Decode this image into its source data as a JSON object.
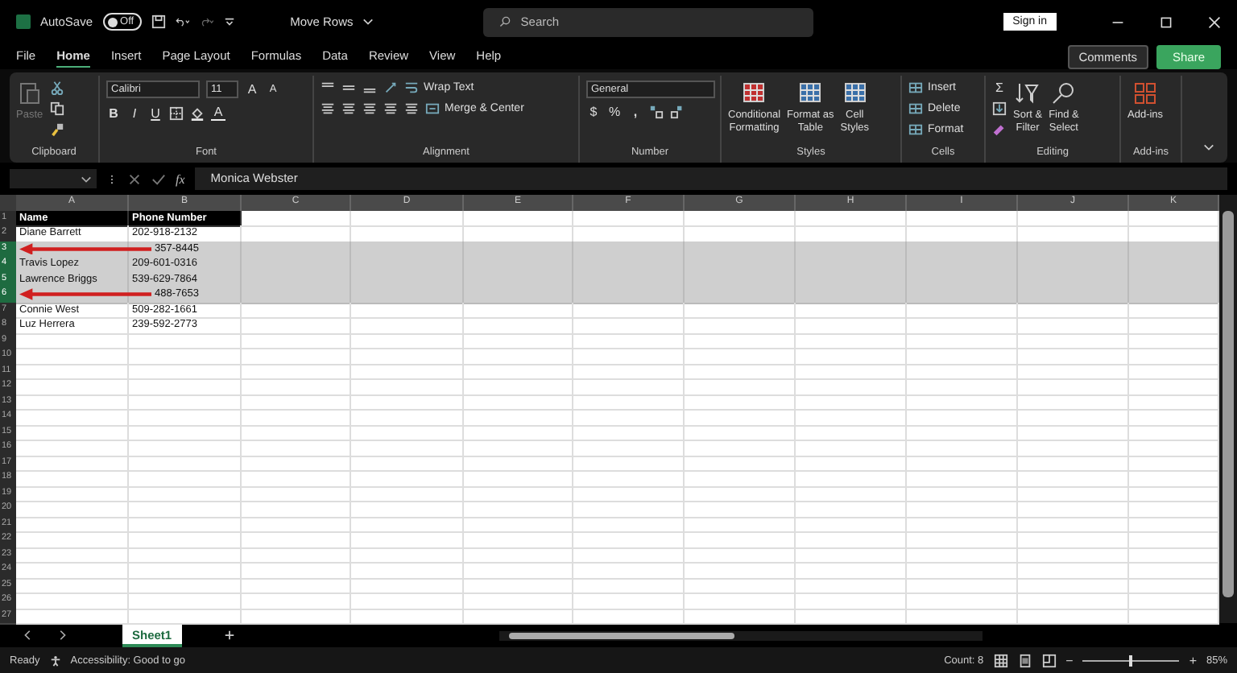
{
  "title_bar": {
    "autosave_label": "AutoSave",
    "autosave_on": false,
    "toggle_text": "Off",
    "document": "Move Rows",
    "search_placeholder": "Search",
    "sign_in": "Sign in"
  },
  "menu_tabs": [
    {
      "label": "File",
      "selected": false
    },
    {
      "label": "Home",
      "selected": true
    },
    {
      "label": "Insert",
      "selected": false
    },
    {
      "label": "Page Layout",
      "selected": false
    },
    {
      "label": "Formulas",
      "selected": false
    },
    {
      "label": "Data",
      "selected": false
    },
    {
      "label": "Review",
      "selected": false
    },
    {
      "label": "View",
      "selected": false
    },
    {
      "label": "Help",
      "selected": false
    }
  ],
  "comments": "Comments",
  "share": "Share",
  "ribbon": [
    {
      "kind": "clipboard",
      "label": "Clipboard",
      "paste": "Paste"
    },
    {
      "kind": "font",
      "label": "Font",
      "font_name": "Calibri",
      "font_size": "11",
      "grow": "A",
      "shrink": "A",
      "bold": "B",
      "italic": "I",
      "underline": "U",
      "font_color": "A"
    },
    {
      "kind": "alignment",
      "label": "Alignment",
      "wrap": "Wrap Text",
      "merge": "Merge & Center"
    },
    {
      "kind": "number",
      "label": "Number",
      "format": "General",
      "currency": "$",
      "percent": "%",
      "comma": ","
    },
    {
      "kind": "styles",
      "label": "Styles",
      "buttons": [
        {
          "line1": "Conditional",
          "line2": "Formatting"
        },
        {
          "line1": "Format as",
          "line2": "Table"
        },
        {
          "line1": "Cell",
          "line2": "Styles"
        }
      ]
    },
    {
      "kind": "cells",
      "label": "Cells",
      "buttons": [
        "Insert",
        "Delete",
        "Format"
      ]
    },
    {
      "kind": "editing",
      "label": "Editing",
      "sum": "Σ",
      "buttons": [
        {
          "line1": "Sort &",
          "line2": "Filter"
        },
        {
          "line1": "Find &",
          "line2": "Select"
        }
      ]
    },
    {
      "kind": "addins",
      "label": "Add-ins",
      "button": "Add-ins"
    }
  ],
  "formula_bar": {
    "fx": "fx",
    "value": "Monica Webster"
  },
  "columns": [
    "A",
    "B",
    "C",
    "D",
    "E",
    "F",
    "G",
    "H",
    "I",
    "J",
    "K"
  ],
  "rows": [
    {
      "number": "1",
      "kind": "header",
      "name": "Name",
      "phone": "Phone Number",
      "selected": false,
      "arrow": false
    },
    {
      "number": "2",
      "name": "Diane Barrett",
      "phone": "202-918-2132",
      "selected": false,
      "arrow": false
    },
    {
      "number": "3",
      "phone": "357-8445",
      "selected": true,
      "arrow": true
    },
    {
      "number": "4",
      "name": "Travis Lopez",
      "phone": "209-601-0316",
      "selected": true,
      "arrow": false
    },
    {
      "number": "5",
      "name": "Lawrence Briggs",
      "phone": "539-629-7864",
      "selected": true,
      "arrow": false
    },
    {
      "number": "6",
      "phone": "488-7653",
      "selected": true,
      "arrow": true
    },
    {
      "number": "7",
      "name": "Connie West",
      "phone": "509-282-1661",
      "selected": false,
      "arrow": false
    },
    {
      "number": "8",
      "name": "Luz Herrera",
      "phone": "239-592-2773",
      "selected": false,
      "arrow": false
    },
    {
      "number": "9"
    },
    {
      "number": "10"
    },
    {
      "number": "11"
    },
    {
      "number": "12"
    },
    {
      "number": "13"
    },
    {
      "number": "14"
    },
    {
      "number": "15"
    },
    {
      "number": "16"
    },
    {
      "number": "17"
    },
    {
      "number": "18"
    },
    {
      "number": "19"
    },
    {
      "number": "20"
    },
    {
      "number": "21"
    },
    {
      "number": "22"
    },
    {
      "number": "23"
    },
    {
      "number": "24"
    },
    {
      "number": "25"
    },
    {
      "number": "26"
    },
    {
      "number": "27"
    }
  ],
  "sheet_tabs": [
    {
      "label": "Sheet1",
      "selected": true
    }
  ],
  "status": {
    "ready": "Ready",
    "accessibility": "Accessibility: Good to go",
    "count": "Count: 8",
    "zoom": "85%",
    "zoom_out": "−",
    "zoom_in": "+",
    "zoom_slider": {
      "level": 0.5
    }
  }
}
